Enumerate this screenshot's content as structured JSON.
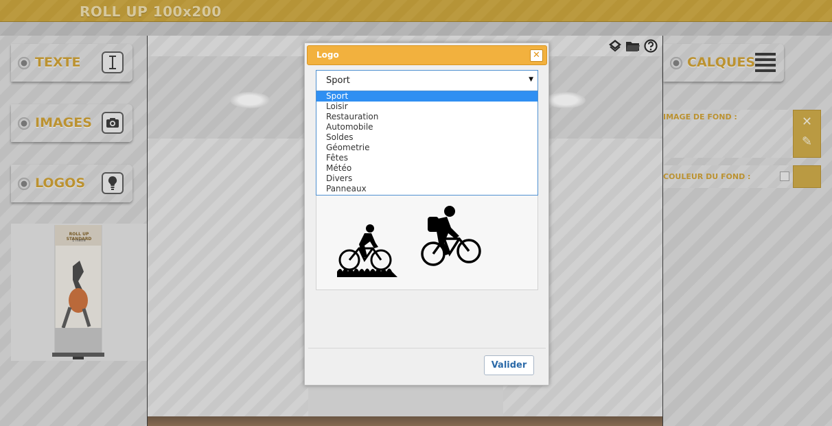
{
  "header": {
    "title": "ROLL UP 100x200"
  },
  "left_tools": [
    {
      "label": "TEXTE",
      "icon": "text-cursor-icon"
    },
    {
      "label": "IMAGES",
      "icon": "camera-icon"
    },
    {
      "label": "LOGOS",
      "icon": "lightbulb-icon"
    }
  ],
  "thumbnail": {
    "title": "ROLL UP STANDARD",
    "subtitle": "1 mètre"
  },
  "canvas_tools": [
    {
      "icon": "layers-icon"
    },
    {
      "icon": "folder-icon"
    },
    {
      "icon": "help-icon"
    }
  ],
  "right_panel": {
    "calques_label": "CALQUES",
    "background_image_label": "IMAGE DE FOND :",
    "background_color_label": "COULEUR DU FOND :"
  },
  "modal": {
    "title": "Logo",
    "category_selected": "Sport",
    "categories": [
      "Sport",
      "Loisir",
      "Restauration",
      "Automobile",
      "Soldes",
      "Géometrie",
      "Fêtes",
      "Météo",
      "Divers",
      "Panneaux"
    ],
    "logos": [
      {
        "icon": "cyclist-on-grass-icon"
      },
      {
        "icon": "mountain-biker-icon"
      }
    ],
    "confirm_label": "Valider"
  },
  "colors": {
    "accent": "#c99a2c",
    "modal_header": "#f2b13e",
    "selected_option": "#2f8ff2"
  }
}
